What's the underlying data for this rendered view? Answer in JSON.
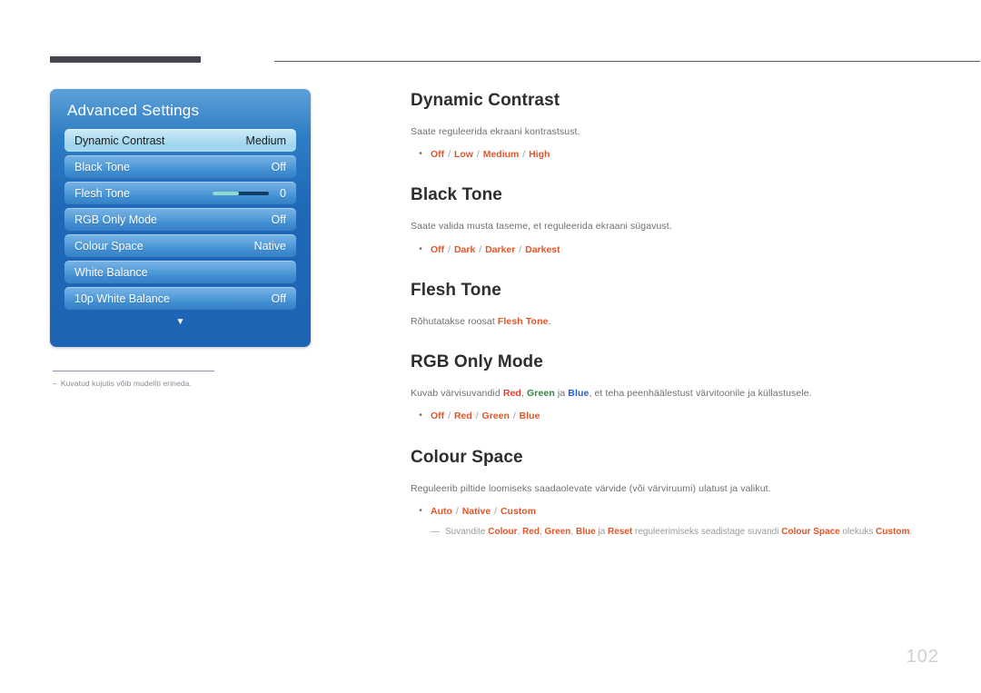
{
  "page": {
    "number": "102"
  },
  "osd": {
    "title": "Advanced Settings",
    "arrow_icon": "▼",
    "rows": [
      {
        "label": "Dynamic Contrast",
        "value": "Medium",
        "selected": true,
        "type": "value"
      },
      {
        "label": "Black Tone",
        "value": "Off",
        "selected": false,
        "type": "value"
      },
      {
        "label": "Flesh Tone",
        "value": "0",
        "selected": false,
        "type": "slider",
        "slider_percent": 47
      },
      {
        "label": "RGB Only Mode",
        "value": "Off",
        "selected": false,
        "type": "value"
      },
      {
        "label": "Colour Space",
        "value": "Native",
        "selected": false,
        "type": "value"
      },
      {
        "label": "White Balance",
        "value": "",
        "selected": false,
        "type": "value"
      },
      {
        "label": "10p White Balance",
        "value": "Off",
        "selected": false,
        "type": "value"
      }
    ]
  },
  "figure_note": {
    "dash": "–",
    "text": "Kuvatud kujutis võib mudeliti erineda."
  },
  "sections": [
    {
      "title": "Dynamic Contrast",
      "description": "Saate reguleerida ekraani kontrastsust.",
      "bullet_dot": "•",
      "options": [
        "Off",
        "Low",
        "Medium",
        "High"
      ]
    },
    {
      "title": "Black Tone",
      "description": "Saate valida musta taseme, et reguleerida ekraani sügavust.",
      "bullet_dot": "•",
      "options": [
        "Off",
        "Dark",
        "Darker",
        "Darkest"
      ]
    },
    {
      "title": "Flesh Tone",
      "description_prefix": "Rõhutatakse roosat ",
      "description_keyword": "Flesh Tone",
      "description_suffix": "."
    },
    {
      "title": "RGB Only Mode",
      "desc_a": "Kuvab värvisuvandid ",
      "desc_red": "Red",
      "desc_b": ", ",
      "desc_green": "Green",
      "desc_c": " ja ",
      "desc_blue": "Blue",
      "desc_d": ", et teha peenhäälestust värvitoonile ja küllastusele.",
      "bullet_dot": "•",
      "options": [
        "Off",
        "Red",
        "Green",
        "Blue"
      ]
    },
    {
      "title": "Colour Space",
      "description": "Reguleerib piltide loomiseks saadaolevate värvide (või värviruumi) ulatust ja valikut.",
      "bullet_dot": "•",
      "options": [
        "Auto",
        "Native",
        "Custom"
      ],
      "subnote": {
        "dash": "—",
        "t1": "Suvandite ",
        "k1": "Colour",
        "t2": ", ",
        "k2": "Red",
        "t3": ", ",
        "k3": "Green",
        "t4": ", ",
        "k4": "Blue",
        "t5": " ja ",
        "k5": "Reset",
        "t6": " reguleerimiseks seadistage suvandi ",
        "k6": "Colour Space",
        "t7": " olekuks ",
        "k7": "Custom",
        "t8": "."
      }
    }
  ],
  "colors": {
    "accent_orange": "#e0562a",
    "red": "#e23b2b",
    "green": "#2f8a3d",
    "blue": "#2b5fc4",
    "heading": "#2e2e2e",
    "body_text": "#6f6f72",
    "osd_blue": "#1f69b8",
    "rule_dark": "#45454f",
    "page_number": "#cfcfd4"
  }
}
